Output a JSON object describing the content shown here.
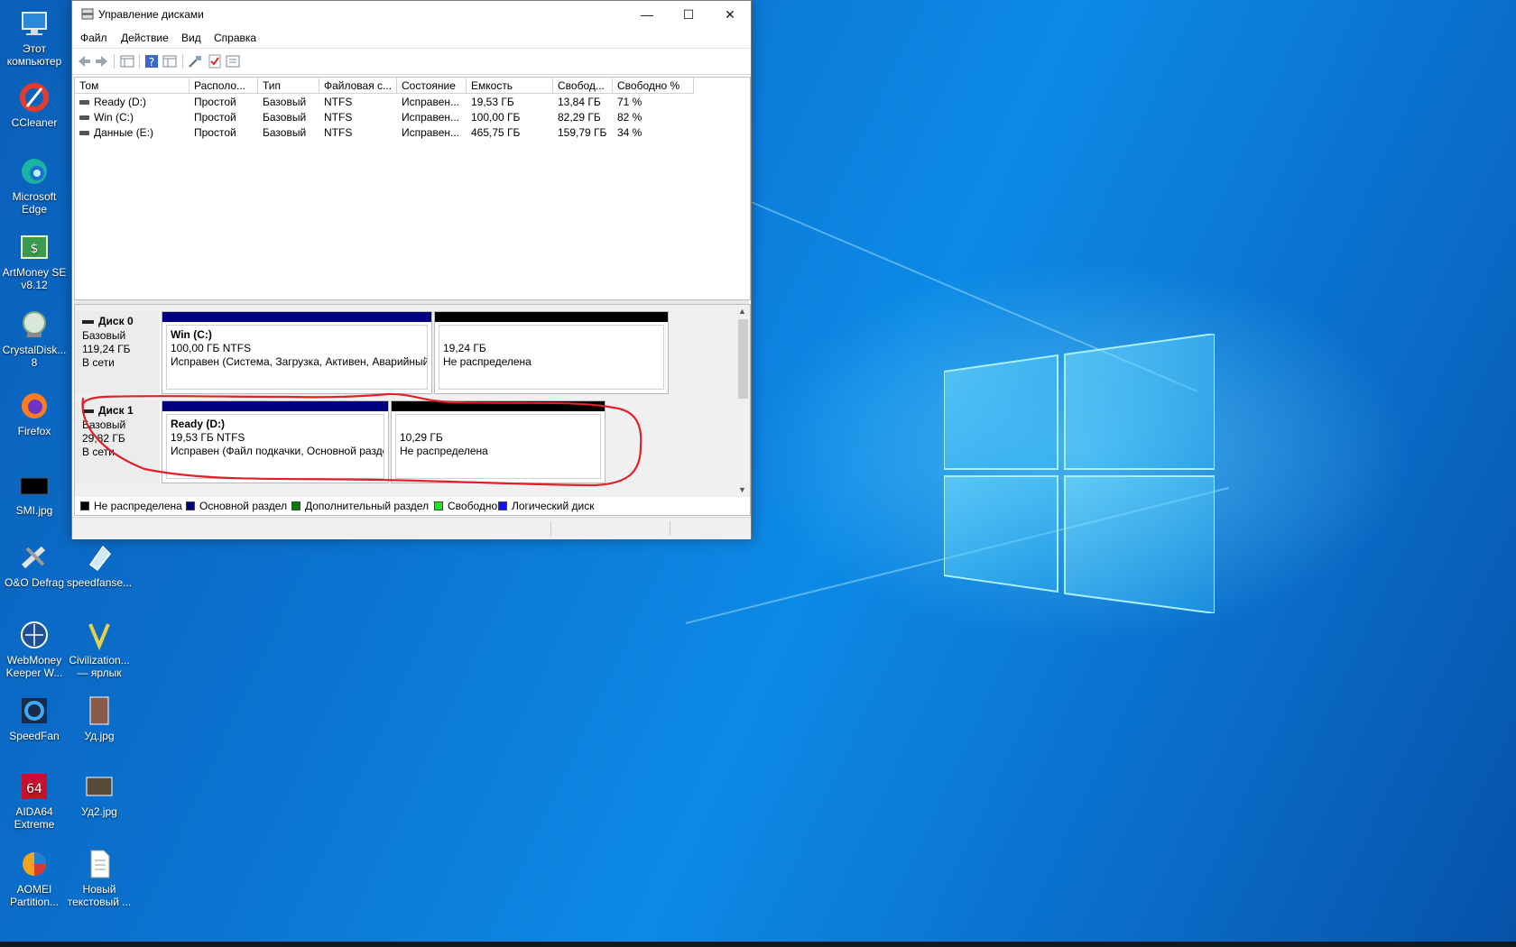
{
  "window": {
    "title": "Управление дисками",
    "controls": {
      "minimize": "—",
      "maximize": "☐",
      "close": "✕"
    }
  },
  "menu": [
    "Файл",
    "Действие",
    "Вид",
    "Справка"
  ],
  "toolbar_icons": [
    "back-icon",
    "forward-icon",
    "console-tree-icon",
    "help-icon",
    "properties-icon",
    "connect-icon",
    "check-icon",
    "show-pane-icon"
  ],
  "volume_table": {
    "headers": [
      "Том",
      "Располо...",
      "Тип",
      "Файловая с...",
      "Состояние",
      "Емкость",
      "Свобод...",
      "Свободно %"
    ],
    "rows": [
      [
        "Ready (D:)",
        "Простой",
        "Базовый",
        "NTFS",
        "Исправен...",
        "19,53 ГБ",
        "13,84 ГБ",
        "71 %"
      ],
      [
        "Win (C:)",
        "Простой",
        "Базовый",
        "NTFS",
        "Исправен...",
        "100,00 ГБ",
        "82,29 ГБ",
        "82 %"
      ],
      [
        "Данные (E:)",
        "Простой",
        "Базовый",
        "NTFS",
        "Исправен...",
        "465,75 ГБ",
        "159,79 ГБ",
        "34 %"
      ]
    ]
  },
  "disks": [
    {
      "name": "Диск 0",
      "type": "Базовый",
      "size": "119,24 ГБ",
      "status": "В сети",
      "partitions": [
        {
          "name": "Win  (C:)",
          "size": "100,00 ГБ NTFS",
          "state": "Исправен (Система, Загрузка, Активен, Аварийный",
          "color": "#00007f"
        },
        {
          "name": "",
          "size": "19,24 ГБ",
          "state": "Не распределена",
          "color": "#000000"
        }
      ]
    },
    {
      "name": "Диск 1",
      "type": "Базовый",
      "size": "29,82 ГБ",
      "status": "В сети",
      "partitions": [
        {
          "name": "Ready  (D:)",
          "size": "19,53 ГБ NTFS",
          "state": "Исправен (Файл подкачки, Основной разде",
          "color": "#00007f"
        },
        {
          "name": "",
          "size": "10,29 ГБ",
          "state": "Не распределена",
          "color": "#000000"
        }
      ]
    }
  ],
  "legend": [
    {
      "label": "Не распределена",
      "color": "#000000"
    },
    {
      "label": "Основной раздел",
      "color": "#00007f"
    },
    {
      "label": "Дополнительный раздел",
      "color": "#007f00"
    },
    {
      "label": "Свободно",
      "color": "#22e022"
    },
    {
      "label": "Логический диск",
      "color": "#1010ff"
    }
  ],
  "desktop_icons": [
    {
      "label": "Этот компьютер",
      "icon": "this-pc-icon"
    },
    {
      "label": "CCleaner",
      "icon": "ccleaner-icon"
    },
    {
      "label": "Microsoft Edge",
      "icon": "edge-icon"
    },
    {
      "label": "ArtMoney SE v8.12",
      "icon": "artmoney-icon"
    },
    {
      "label": "CrystalDisk... 8",
      "icon": "crystaldisk-icon"
    },
    {
      "label": "Firefox",
      "icon": "firefox-icon"
    },
    {
      "label": "SMI.jpg",
      "icon": "image-file-icon"
    },
    {
      "label": "O&O Defrag",
      "icon": "defrag-icon"
    },
    {
      "label": "speedfanse...",
      "icon": "file-icon"
    },
    {
      "label": "WebMoney Keeper W...",
      "icon": "webmoney-icon"
    },
    {
      "label": "Civilization... — ярлык",
      "icon": "civilization-icon"
    },
    {
      "label": "SpeedFan",
      "icon": "speedfan-icon"
    },
    {
      "label": "Уд.jpg",
      "icon": "image-file-icon"
    },
    {
      "label": "AIDA64 Extreme",
      "icon": "aida64-icon"
    },
    {
      "label": "Уд2.jpg",
      "icon": "image-file-icon"
    },
    {
      "label": "AOMEI Partition...",
      "icon": "aomei-icon"
    },
    {
      "label": "Новый текстовый ...",
      "icon": "text-file-icon"
    }
  ],
  "colors": {
    "annotation": "#e0202a",
    "primary_partition": "#00007f",
    "unallocated": "#000000"
  }
}
